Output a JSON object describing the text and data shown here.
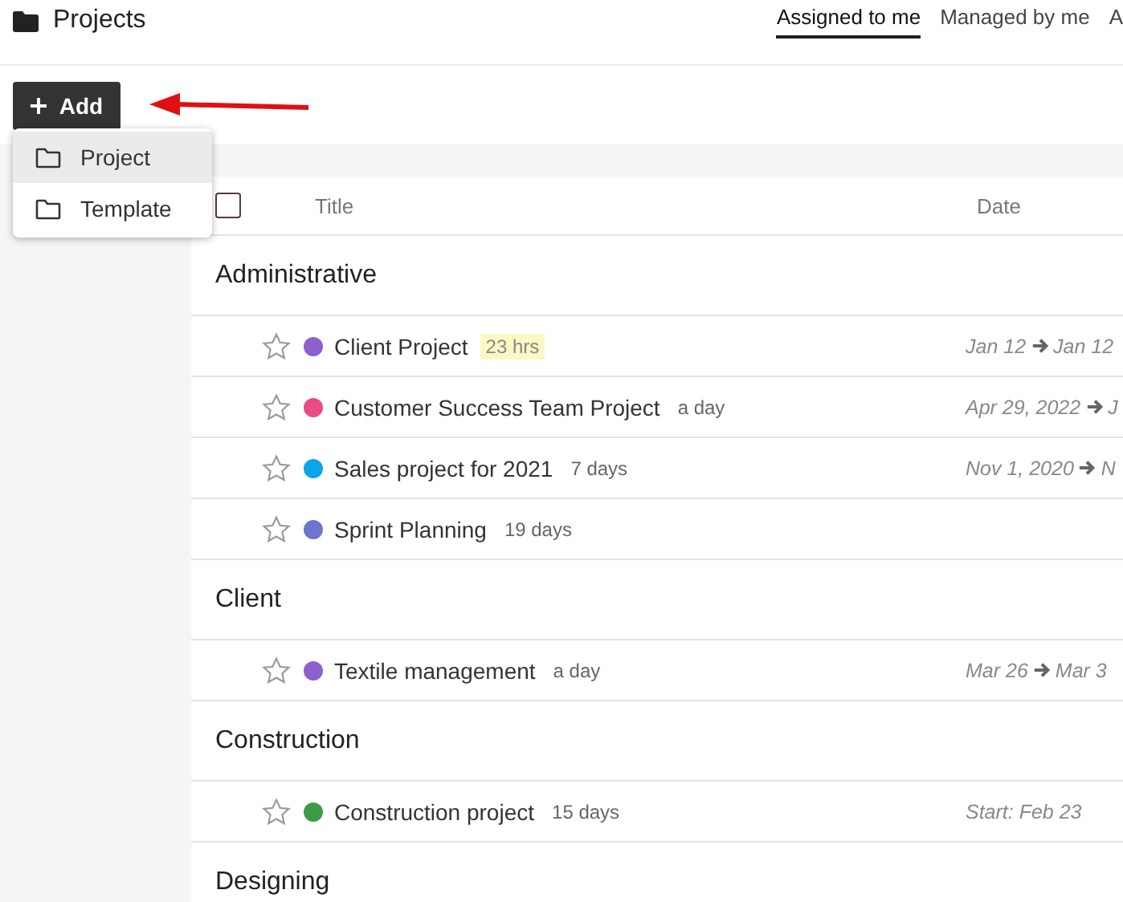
{
  "header": {
    "title": "Projects"
  },
  "tabs": [
    {
      "label": "Assigned to me",
      "selected": true
    },
    {
      "label": "Managed by me",
      "selected": false
    },
    {
      "label": "A",
      "selected": false
    }
  ],
  "add_button": {
    "label": "Add"
  },
  "add_menu": [
    {
      "label": "Project",
      "selected": true
    },
    {
      "label": "Template",
      "selected": false
    }
  ],
  "table": {
    "select_all": {
      "checked": false
    },
    "columns": [
      "Title",
      "Date"
    ],
    "groups": [
      {
        "name": "Administrative",
        "rows": [
          {
            "title": "Client Project",
            "age": "23 hrs",
            "age_highlight": true,
            "color": "#8e5fcf",
            "starred": false,
            "date_start": "Jan 12",
            "date_end": "Jan 12"
          },
          {
            "title": "Customer Success Team Project",
            "age": "a day",
            "age_highlight": false,
            "color": "#e94c84",
            "starred": false,
            "date_start": "Apr 29, 2022",
            "date_end": "J"
          },
          {
            "title": "Sales project for 2021",
            "age": "7 days",
            "age_highlight": false,
            "color": "#0ba5e9",
            "starred": false,
            "date_start": "Nov 1, 2020",
            "date_end": "N"
          },
          {
            "title": "Sprint Planning",
            "age": "19 days",
            "age_highlight": false,
            "color": "#6a77cc",
            "starred": false
          }
        ]
      },
      {
        "name": "Client",
        "rows": [
          {
            "title": "Textile management",
            "age": "a day",
            "age_highlight": false,
            "color": "#8e5fcf",
            "starred": false,
            "date_start": "Mar 26",
            "date_end": "Mar 3"
          }
        ]
      },
      {
        "name": "Construction",
        "rows": [
          {
            "title": "Construction project",
            "age": "15 days",
            "age_highlight": false,
            "color": "#3d9a45",
            "starred": false,
            "date_start": "Start: Feb 23"
          }
        ]
      },
      {
        "name": "Designing"
      }
    ]
  }
}
